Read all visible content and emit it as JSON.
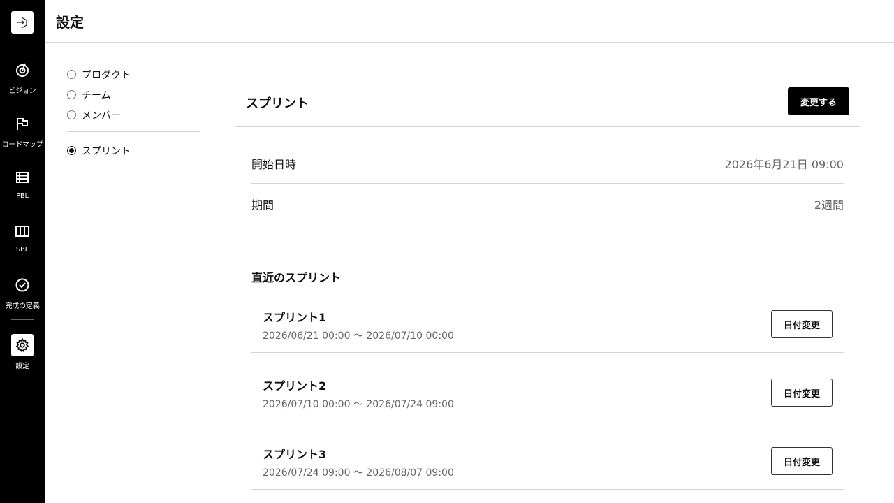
{
  "header": {
    "title": "設定"
  },
  "nav": {
    "logo_icon": "door-exit-icon",
    "items": [
      {
        "label": "ビジョン",
        "icon": "target-icon"
      },
      {
        "label": "ロードマップ",
        "icon": "flag-icon"
      },
      {
        "label": "PBL",
        "icon": "list-icon"
      },
      {
        "label": "SBL",
        "icon": "columns-icon"
      },
      {
        "label": "完成の定義",
        "icon": "check-circle-icon"
      },
      {
        "label": "設定",
        "icon": "gear-icon",
        "active": true
      }
    ]
  },
  "submenu": {
    "items": [
      {
        "label": "プロダクト",
        "checked": false
      },
      {
        "label": "チーム",
        "checked": false
      },
      {
        "label": "メンバー",
        "checked": false
      },
      {
        "label": "スプリント",
        "checked": true
      }
    ]
  },
  "section": {
    "title": "スプリント",
    "change_label": "変更する",
    "start_label": "開始日時",
    "start_value": "2026年6月21日 09:00",
    "period_label": "期間",
    "period_value": "2週間"
  },
  "recent": {
    "title": "直近のスプリント",
    "change_date_label": "日付変更",
    "sprints": [
      {
        "name": "スプリント1",
        "range": "2026/06/21 00:00 〜 2026/07/10 00:00"
      },
      {
        "name": "スプリント2",
        "range": "2026/07/10 00:00 〜 2026/07/24 09:00"
      },
      {
        "name": "スプリント3",
        "range": "2026/07/24 09:00 〜 2026/08/07 09:00"
      }
    ]
  },
  "colors": {
    "rail": "#000000",
    "accent": "#000000",
    "muted": "#666666",
    "divider": "#d6d6d6"
  }
}
